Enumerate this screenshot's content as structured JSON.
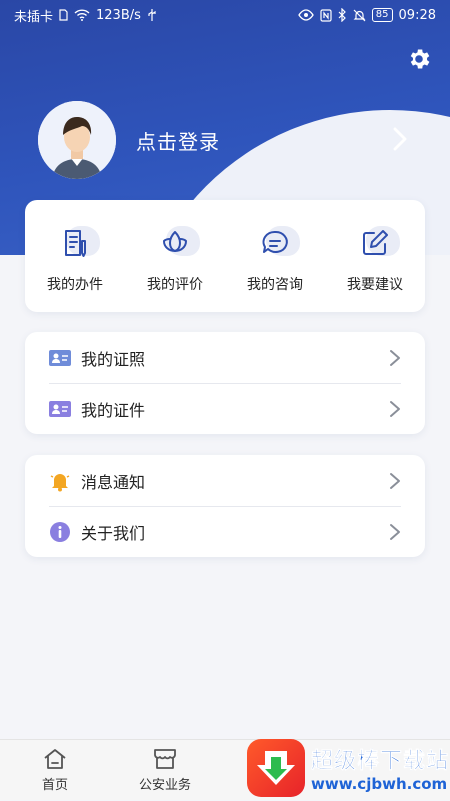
{
  "status_bar": {
    "carrier": "未插卡",
    "net_speed": "123B/s",
    "battery": "85",
    "time": "09:28"
  },
  "profile": {
    "login_label": "点击登录"
  },
  "quick_actions": [
    {
      "label": "我的办件",
      "icon": "document-edit-icon"
    },
    {
      "label": "我的评价",
      "icon": "lotus-icon"
    },
    {
      "label": "我的咨询",
      "icon": "chat-bubble-icon"
    },
    {
      "label": "我要建议",
      "icon": "pencil-square-icon"
    }
  ],
  "menu_group_1": [
    {
      "label": "我的证照",
      "icon": "id-card-icon"
    },
    {
      "label": "我的证件",
      "icon": "id-card-icon"
    }
  ],
  "menu_group_2": [
    {
      "label": "消息通知",
      "icon": "bell-icon"
    },
    {
      "label": "关于我们",
      "icon": "info-icon"
    }
  ],
  "bottom_nav": [
    {
      "label": "首页",
      "icon": "home-icon"
    },
    {
      "label": "公安业务",
      "icon": "store-icon"
    }
  ],
  "watermark": {
    "title": "超级棒下载站",
    "url": "www.cjbwh.com"
  },
  "colors": {
    "primary": "#2f55bc",
    "icon_stroke": "#2f4fae",
    "card_icon_bg": "#6f8cd9",
    "bell": "#f3a623",
    "info": "#8a7fe0"
  }
}
